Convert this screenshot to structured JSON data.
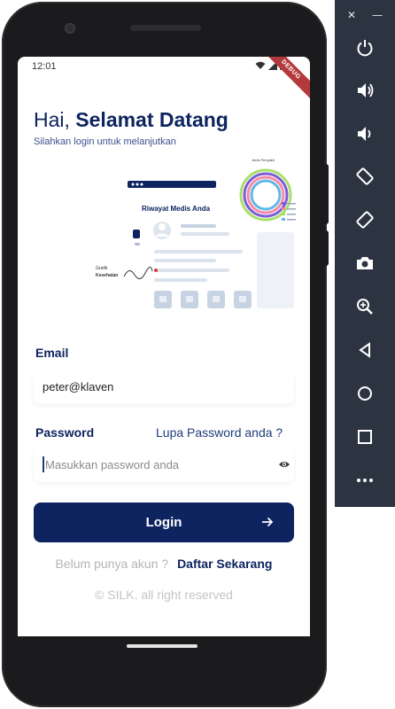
{
  "status_bar": {
    "time": "12:01",
    "debug_ribbon": "DEBUG"
  },
  "greeting": {
    "hello": "Hai,",
    "title": "Selamat Datang",
    "subtitle": "Silahkan login untuk melanjutkan"
  },
  "illustration": {
    "card_title": "Riwayat Medis Anda",
    "graph_label_1": "Grafik",
    "graph_label_2": "Kesehatan",
    "chart_label": "Jenis Penyakit"
  },
  "form": {
    "email_label": "Email",
    "email_value": "peter@klaven",
    "password_label": "Password",
    "forgot_link": "Lupa Password anda ?",
    "password_placeholder": "Masukkan password anda",
    "login_label": "Login"
  },
  "register": {
    "question": "Belum punya akun ?",
    "link": "Daftar Sekarang"
  },
  "footer": {
    "text": "© SILK. all right reserved"
  },
  "emulator_toolbar": {
    "window_controls": [
      "close-icon",
      "minimize-icon"
    ],
    "buttons": [
      "power-icon",
      "volume-up-icon",
      "volume-down-icon",
      "rotate-left-icon",
      "rotate-right-icon",
      "camera-icon",
      "zoom-icon",
      "back-icon",
      "home-icon",
      "overview-icon",
      "more-icon"
    ]
  },
  "colors": {
    "primary": "#0d2460",
    "toolbar": "#2b3440",
    "ribbon": "#b4393d"
  }
}
